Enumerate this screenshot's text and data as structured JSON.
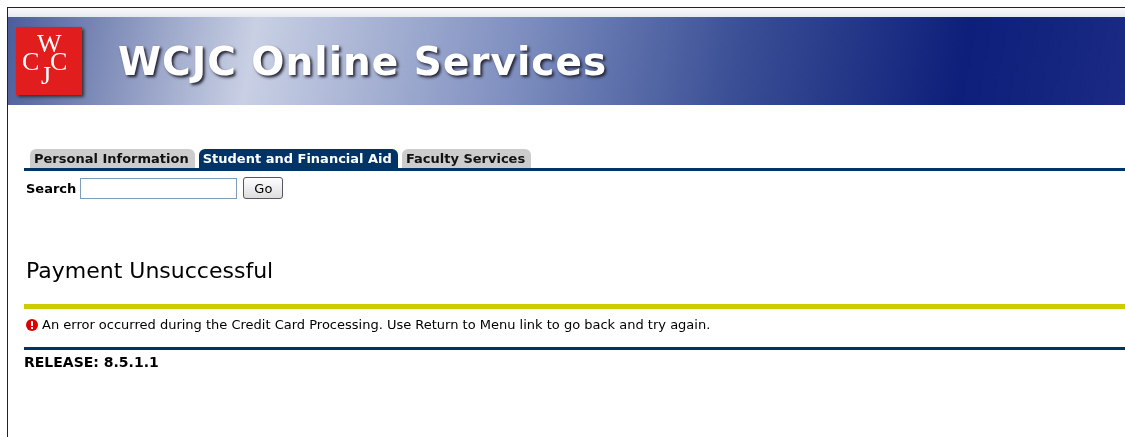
{
  "banner": {
    "logo_letters": [
      "W",
      "C",
      "J",
      "C"
    ],
    "title": "WCJC Online Services"
  },
  "tabs": [
    {
      "label": "Personal Information",
      "selected": false
    },
    {
      "label": "Student and Financial Aid",
      "selected": true
    },
    {
      "label": "Faculty Services",
      "selected": false
    }
  ],
  "search": {
    "label": "Search",
    "button": "Go"
  },
  "page_title": "Payment Unsuccessful",
  "error_message": "An error occurred during the Credit Card Processing. Use Return to Menu link to go back and try again.",
  "release": "RELEASE: 8.5.1.1"
}
